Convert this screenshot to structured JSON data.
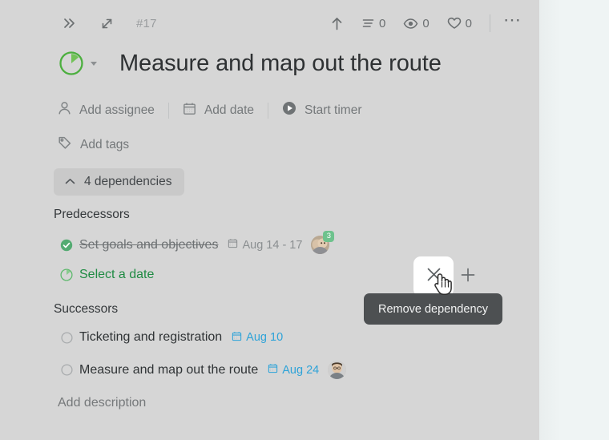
{
  "topbar": {
    "collapse_icon": "double-chevron-right-icon",
    "expand_icon": "diagonal-arrows-icon",
    "task_id": "#17",
    "share_icon": "up-arrow-icon",
    "comments": {
      "icon": "comment-lines-icon",
      "count": "0"
    },
    "watchers": {
      "icon": "eye-icon",
      "count": "0"
    },
    "likes": {
      "icon": "heart-icon",
      "count": "0"
    },
    "more_icon": "ellipsis-icon"
  },
  "header": {
    "status_icon": "status-pie-icon",
    "status_color": "#4caf3f",
    "status_caret": "caret-down-icon",
    "title": "Measure and map out the route"
  },
  "actions": [
    {
      "icon": "person-icon",
      "label": "Add assignee"
    },
    {
      "icon": "calendar-icon",
      "label": "Add date"
    },
    {
      "icon": "play-circle-icon",
      "label": "Start timer"
    }
  ],
  "actions_row2": [
    {
      "icon": "tag-icon",
      "label": "Add tags"
    }
  ],
  "dependencies": {
    "toggle_icon": "chevron-up-icon",
    "toggle_label": "4 dependencies",
    "predecessors_heading": "Predecessors",
    "successors_heading": "Successors",
    "predecessors": [
      {
        "mark": "check-circle-filled-icon",
        "title": "Set goals and objectives",
        "completed": true,
        "date_icon": "calendar-icon",
        "date": "Aug 14 - 17",
        "date_color": "#8b8f91",
        "avatar": {
          "badge": "3",
          "badge_color": "#6ec28d"
        }
      },
      {
        "mark": "status-pie-green-icon",
        "title": "Select a date",
        "completed": false,
        "date_icon": "",
        "date": "",
        "date_color": "#1f8b43",
        "avatar": null
      }
    ],
    "successors": [
      {
        "mark": "circle-outline-icon",
        "title": "Ticketing and registration",
        "completed": false,
        "date_icon": "calendar-icon",
        "date": "Aug 10",
        "date_color": "#2ea3d8",
        "avatar": null
      },
      {
        "mark": "circle-outline-icon",
        "title": "Measure and map out the route",
        "completed": false,
        "date_icon": "calendar-icon",
        "date": "Aug 24",
        "date_color": "#2ea3d8",
        "avatar": {
          "badge": "",
          "badge_color": ""
        }
      }
    ]
  },
  "hover_controls": {
    "remove_icon": "close-x-icon",
    "add_icon": "plus-icon",
    "tooltip": "Remove dependency",
    "cursor": "pointing-hand-cursor"
  },
  "description": {
    "placeholder": "Add description"
  },
  "colors": {
    "panel_bg": "#d6d6d6",
    "page_bg": "#eff4f4",
    "green": "#4caf3f",
    "blue": "#2ea3d8",
    "tooltip_bg": "#4d5052"
  }
}
